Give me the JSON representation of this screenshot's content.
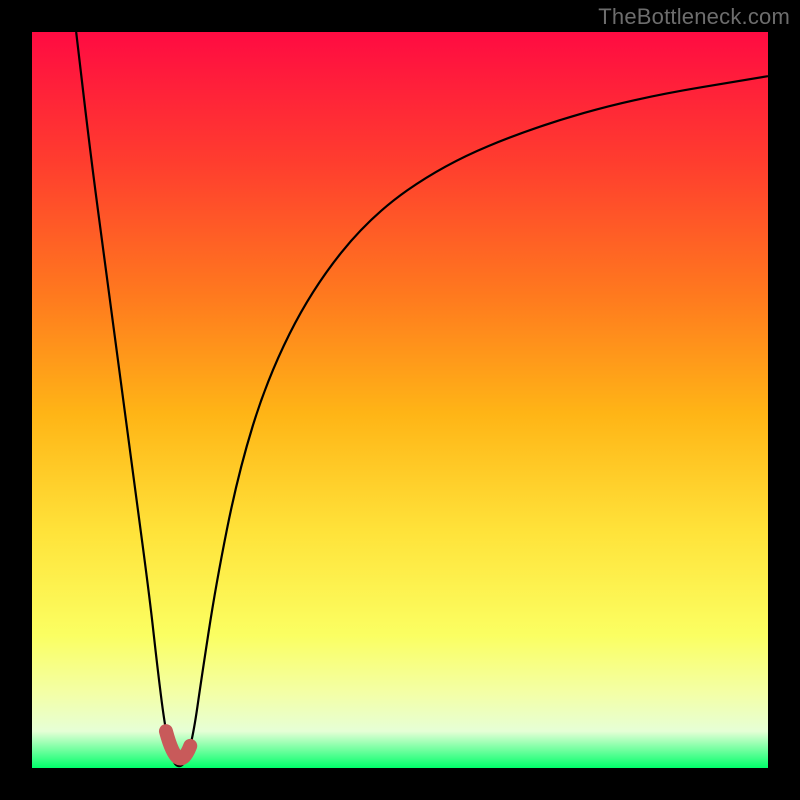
{
  "watermark": "TheBottleneck.com",
  "chart_data": {
    "type": "line",
    "title": "",
    "xlabel": "",
    "ylabel": "",
    "xlim": [
      0,
      100
    ],
    "ylim": [
      0,
      100
    ],
    "grid": false,
    "legend": false,
    "series": [
      {
        "name": "curve",
        "x": [
          6,
          8,
          10,
          12,
          14,
          16,
          17,
          18,
          19,
          20,
          21,
          22,
          23,
          25,
          28,
          32,
          38,
          46,
          56,
          68,
          82,
          100
        ],
        "y": [
          100,
          83,
          68,
          53,
          38,
          23,
          14,
          6,
          1,
          0,
          1,
          5,
          12,
          25,
          40,
          53,
          65,
          75,
          82,
          87,
          91,
          94
        ]
      }
    ],
    "highlight_region": {
      "series": "curve",
      "x_range": [
        18.2,
        21.5
      ],
      "note": "valley"
    }
  }
}
